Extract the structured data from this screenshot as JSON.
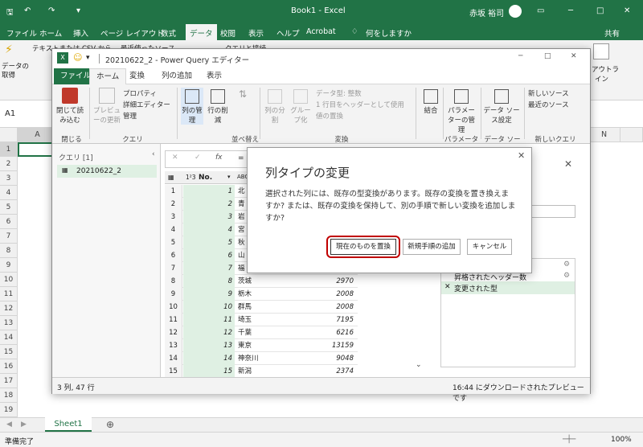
{
  "excel": {
    "title": "Book1 - Excel",
    "user": "赤坂 裕司",
    "menu": [
      "ファイル",
      "ホーム",
      "挿入",
      "ページ レイアウト",
      "数式",
      "データ",
      "校閲",
      "表示",
      "ヘルプ",
      "Acrobat",
      "何をしますか"
    ],
    "share": "共有",
    "ribbon_partial": {
      "get_data": "データの取得",
      "text_csv": "テキストまたは CSV から",
      "recent": "最近使ったソース",
      "connections": "クエリと接続",
      "right1": "アウトラ",
      "right2": "イン"
    },
    "name_box": "A1",
    "columns": [
      "A",
      "N"
    ],
    "rows": [
      "1",
      "2",
      "3",
      "4",
      "5",
      "6",
      "7",
      "8",
      "9",
      "10",
      "11",
      "12",
      "13",
      "14",
      "15",
      "16",
      "17",
      "18",
      "19"
    ],
    "sheet_tab": "Sheet1",
    "status_left": "準備完了",
    "zoom": "100%"
  },
  "pq": {
    "title": "20210622_2 - Power Query エディター",
    "tabs": [
      "ファイル",
      "ホーム",
      "変換",
      "列の追加",
      "表示"
    ],
    "ribbon": {
      "close_load": "閉じて読み込む",
      "preview_refresh": "プレビューの更新",
      "properties": "プロパティ",
      "advanced_editor": "詳細エディター",
      "manage": "管理",
      "choose_cols": "列の管理",
      "remove_rows": "行の削減",
      "sort": "並べ替え",
      "split": "列の分割",
      "group": "グループ化",
      "data_type": "データ型: 整数",
      "first_row_header": "1 行目をヘッダーとして使用",
      "replace_values": "値の置換",
      "combine": "結合",
      "params": "パラメーターの管理",
      "datasource": "データ ソース設定",
      "new_source": "新しいソース",
      "recent_sources": "最近のソース",
      "groups": {
        "close": "閉じる",
        "query": "クエリ",
        "transform": "変換",
        "params": "パラメーター",
        "datasource": "データ ソース",
        "newquery": "新しいクエリ"
      }
    },
    "queries_header": "クエリ [1]",
    "query_item": "20210622_2",
    "formula_eq": "=",
    "col_header_no": "No.",
    "col_type_no": "1²3",
    "col_type_2": "ABC",
    "rows": [
      {
        "n": "1",
        "no": "1",
        "name": "北",
        "val": ""
      },
      {
        "n": "2",
        "no": "2",
        "name": "青",
        "val": ""
      },
      {
        "n": "3",
        "no": "3",
        "name": "岩",
        "val": ""
      },
      {
        "n": "4",
        "no": "4",
        "name": "宮",
        "val": ""
      },
      {
        "n": "5",
        "no": "5",
        "name": "秋",
        "val": ""
      },
      {
        "n": "6",
        "no": "6",
        "name": "山",
        "val": ""
      },
      {
        "n": "7",
        "no": "7",
        "name": "福",
        "val": ""
      },
      {
        "n": "8",
        "no": "8",
        "name": "茨城",
        "val": "2970"
      },
      {
        "n": "9",
        "no": "9",
        "name": "栃木",
        "val": "2008"
      },
      {
        "n": "10",
        "no": "10",
        "name": "群馬",
        "val": "2008"
      },
      {
        "n": "11",
        "no": "11",
        "name": "埼玉",
        "val": "7195"
      },
      {
        "n": "12",
        "no": "12",
        "name": "千葉",
        "val": "6216"
      },
      {
        "n": "13",
        "no": "13",
        "name": "東京",
        "val": "13159"
      },
      {
        "n": "14",
        "no": "14",
        "name": "神奈川",
        "val": "9048"
      },
      {
        "n": "15",
        "no": "15",
        "name": "新潟",
        "val": "2374"
      }
    ],
    "steps": [
      "昇格されたヘッダー数",
      "変更された型"
    ],
    "status_left": "3 列, 47 行",
    "status_right": "16:44 にダウンロードされたプレビューです"
  },
  "dialog": {
    "title": "列タイプの変更",
    "message": "選択された列には、既存の型変換があります。既存の変換を置き換えますか? または、既存の変換を保持して、別の手順で新しい変換を追加しますか?",
    "btn_replace": "現在のものを置換",
    "btn_add": "新規手順の追加",
    "btn_cancel": "キャンセル",
    "highlight_color": "#c00000"
  }
}
